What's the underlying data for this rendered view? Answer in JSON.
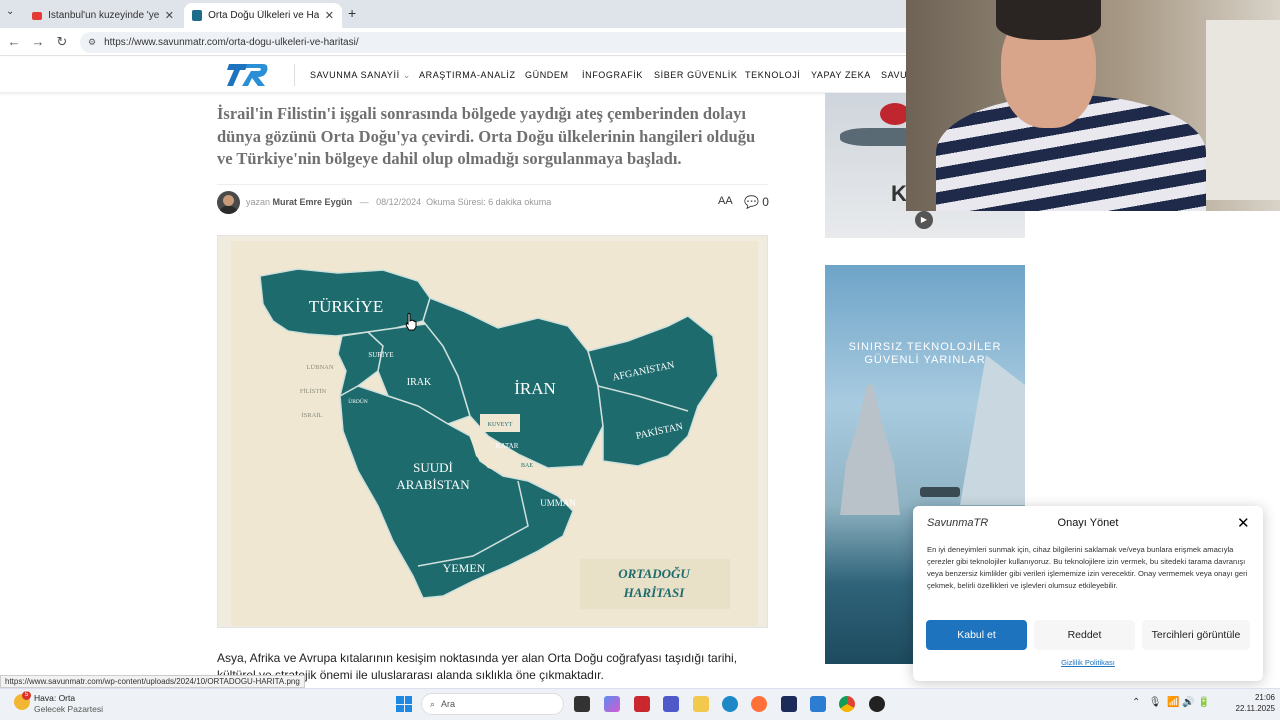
{
  "browser": {
    "tabs": [
      {
        "title": "İstanbul'un kuzeyinde 'yeni bi...",
        "active": false
      },
      {
        "title": "Orta Doğu Ülkeleri ve Haritası -",
        "active": true
      }
    ],
    "new_tab": "+",
    "url": "https://www.savunmatr.com/orta-dogu-ulkeleri-ve-haritasi/"
  },
  "site": {
    "logo": "TR",
    "nav": [
      "SAVUNMA SANAYİİ",
      "ARAŞTIRMA-ANALİZ",
      "GÜNDEM",
      "İNFOGRAFİK",
      "SİBER GÜVENLİK",
      "TEKNOLOJİ",
      "YAPAY ZEKA",
      "SAVU"
    ]
  },
  "article": {
    "lead": "İsrail'in Filistin'i işgali sonrasında bölgede yaydığı ateş çemberinden dolayı dünya gözünü Orta Doğu'ya çevirdi. Orta Doğu ülkelerinin hangileri olduğu ve Türkiye'nin bölgeye dahil olup olmadığı sorgulanmaya başladı.",
    "author_prefix": "yazan",
    "author": "Murat Emre Eygün",
    "separator": "—",
    "date": "08/12/2024",
    "reading_time": "Okuma Süresi: 6 dakika okuma",
    "font_size_label": "AA",
    "comments": "0",
    "body": "Asya, Afrika ve Avrupa kıtalarının kesişim noktasında yer alan Orta Doğu coğrafyası taşıdığı tarihi, kültürel ve stratejik önemi ile uluslararası alanda sıklıkla öne çıkmaktadır."
  },
  "map": {
    "countries": [
      "TÜRKİYE",
      "SURİYE",
      "LÜBNAN",
      "FİLİSTİN",
      "İSRAİL",
      "ÜRDÜN",
      "IRAK",
      "İRAN",
      "AFGANİSTAN",
      "PAKİSTAN",
      "KUVEYT",
      "KATAR",
      "BAE",
      "SUUDİ",
      "ARABİSTAN",
      "UMMAN",
      "YEMEN"
    ],
    "caption_line1": "ORTADOĞU",
    "caption_line2": "HARİTASI",
    "land_color": "#1e6b6e",
    "paper_color": "#efe7d2"
  },
  "ads": {
    "ad2_line1": "SINIRSIZ TEKNOLOJİLER",
    "ad2_line2": "GÜVENLİ YARINLAR"
  },
  "consent": {
    "logo": "SavunmaTR",
    "title": "Onayı Yönet",
    "text": "En iyi deneyimleri sunmak için, cihaz bilgilerini saklamak ve/veya bunlara erişmek amacıyla çerezler gibi teknolojiler kullanıyoruz. Bu teknolojilere izin vermek, bu sitedeki tarama davranışı veya benzersiz kimlikler gibi verileri işlememize izin verecektir. Onay vermemek veya onayı geri çekmek, belirli özellikleri ve işlevleri olumsuz etkileyebilir.",
    "accept": "Kabul et",
    "reject": "Reddet",
    "preferences": "Tercihleri görüntüle",
    "privacy": "Gizlilik Politikası",
    "accent": "#1e73be"
  },
  "status_url": "https://www.savunmatr.com/wp-content/uploads/2024/10/ORTADOGU-HARITA.png",
  "taskbar": {
    "weather_badge": "5",
    "weather_line1": "Hava: Orta",
    "weather_line2": "Gelecek Pazartesi",
    "search": "Ara",
    "time": "21:06",
    "date": "22.11.2025"
  }
}
